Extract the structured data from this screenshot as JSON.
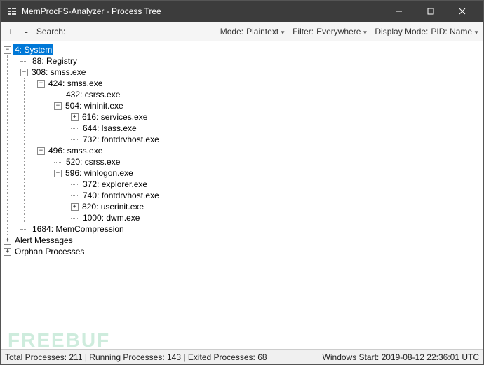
{
  "window": {
    "title": "MemProcFS-Analyzer - Process Tree"
  },
  "toolbar": {
    "plus": "+",
    "minus": "-",
    "search_label": "Search:",
    "search_value": "",
    "mode_label": "Mode:",
    "mode_value": "Plaintext",
    "filter_label": "Filter:",
    "filter_value": "Everywhere",
    "display_label": "Display Mode:",
    "display_value": "PID: Name"
  },
  "tree": {
    "root": {
      "pid": 4,
      "name": "System",
      "label": "4: System",
      "expanded": true,
      "selected": true,
      "children": [
        {
          "pid": 88,
          "name": "Registry",
          "label": "88: Registry"
        },
        {
          "pid": 308,
          "name": "smss.exe",
          "label": "308: smss.exe",
          "expanded": true,
          "children": [
            {
              "pid": 424,
              "name": "smss.exe",
              "label": "424: smss.exe",
              "expanded": true,
              "children": [
                {
                  "pid": 432,
                  "name": "csrss.exe",
                  "label": "432: csrss.exe"
                },
                {
                  "pid": 504,
                  "name": "wininit.exe",
                  "label": "504: wininit.exe",
                  "expanded": true,
                  "children": [
                    {
                      "pid": 616,
                      "name": "services.exe",
                      "label": "616: services.exe",
                      "expanded": false,
                      "hasChildren": true
                    },
                    {
                      "pid": 644,
                      "name": "lsass.exe",
                      "label": "644: lsass.exe"
                    },
                    {
                      "pid": 732,
                      "name": "fontdrvhost.exe",
                      "label": "732: fontdrvhost.exe"
                    }
                  ]
                }
              ]
            },
            {
              "pid": 496,
              "name": "smss.exe",
              "label": "496: smss.exe",
              "expanded": true,
              "children": [
                {
                  "pid": 520,
                  "name": "csrss.exe",
                  "label": "520: csrss.exe"
                },
                {
                  "pid": 596,
                  "name": "winlogon.exe",
                  "label": "596: winlogon.exe",
                  "expanded": true,
                  "children": [
                    {
                      "pid": 372,
                      "name": "explorer.exe",
                      "label": "372: explorer.exe"
                    },
                    {
                      "pid": 740,
                      "name": "fontdrvhost.exe",
                      "label": "740: fontdrvhost.exe"
                    },
                    {
                      "pid": 820,
                      "name": "userinit.exe",
                      "label": "820: userinit.exe",
                      "expanded": false,
                      "hasChildren": true
                    },
                    {
                      "pid": 1000,
                      "name": "dwm.exe",
                      "label": "1000: dwm.exe"
                    }
                  ]
                }
              ]
            }
          ]
        },
        {
          "pid": 1684,
          "name": "MemCompression",
          "label": "1684: MemCompression"
        }
      ]
    },
    "extra": [
      {
        "label": "Alert Messages",
        "expanded": false,
        "hasChildren": true
      },
      {
        "label": "Orphan Processes",
        "expanded": false,
        "hasChildren": true
      }
    ]
  },
  "status": {
    "left": "Total Processes: 211 | Running Processes: 143 | Exited Processes: 68",
    "right": "Windows Start: 2019-08-12 22:36:01 UTC"
  },
  "watermark": "FREEBUF"
}
